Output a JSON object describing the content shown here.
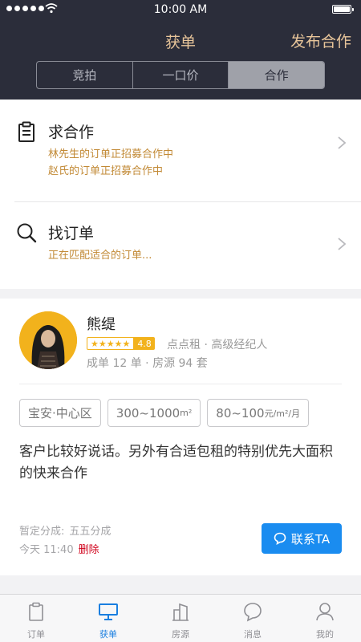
{
  "status_bar": {
    "time": "10:00 AM"
  },
  "nav": {
    "title": "获单",
    "action": "发布合作"
  },
  "segments": [
    {
      "label": "竞拍",
      "active": false
    },
    {
      "label": "一口价",
      "active": false
    },
    {
      "label": "合作",
      "active": true
    }
  ],
  "rows": {
    "seek": {
      "icon": "clipboard-icon",
      "title": "求合作",
      "lines": [
        "林先生的订单正招募合作中",
        "赵氏的订单正招募合作中"
      ]
    },
    "find": {
      "icon": "search-icon",
      "title": "找订单",
      "lines": [
        "正在匹配适合的订单..."
      ]
    }
  },
  "post": {
    "name": "熊缇",
    "stars": "★★★★★",
    "score": "4.8",
    "company": "点点租 · 高级经纪人",
    "stats": "成单 12 单 · 房源 94 套",
    "tags": [
      {
        "text": "宝安·中心区",
        "unit": ""
      },
      {
        "text": "300~1000",
        "unit": "m²"
      },
      {
        "text": "80~100",
        "unit": "元/m²/月"
      }
    ],
    "description": "客户比较好说话。另外有合适包租的特别优先大面积的快来合作",
    "split_label": "暂定分成:",
    "split_value": "五五分成",
    "time": "今天 11:40",
    "delete": "删除",
    "contact": "联系TA"
  },
  "tabs": [
    {
      "label": "订单",
      "icon": "clipboard-icon",
      "active": false
    },
    {
      "label": "获单",
      "icon": "monitor-icon",
      "active": true
    },
    {
      "label": "房源",
      "icon": "building-icon",
      "active": false
    },
    {
      "label": "消息",
      "icon": "chat-bubble-icon",
      "active": false
    },
    {
      "label": "我的",
      "icon": "person-icon",
      "active": false
    }
  ],
  "colors": {
    "header": "#2b2d3a",
    "gold": "#e8c59a",
    "accent": "#1a8cf0",
    "rating": "#f2b21c",
    "delete": "#d0021b"
  }
}
